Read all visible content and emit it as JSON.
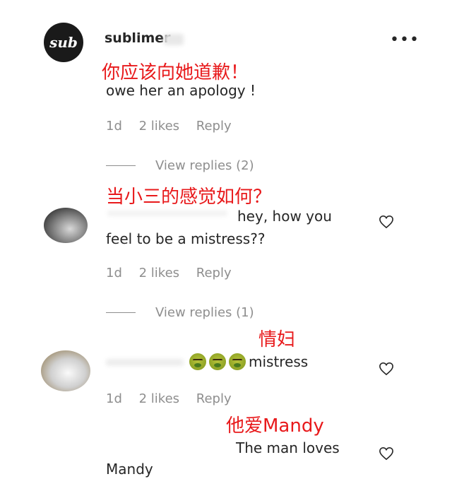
{
  "comments": [
    {
      "username": "sublimer",
      "avatar_text": "sub",
      "translation": "你应该向她道歉！",
      "text": "owe her an apology !",
      "time": "1d",
      "likes": "2 likes",
      "reply": "Reply",
      "view_replies": "View replies (2)"
    },
    {
      "translation": "当小三的感觉如何？",
      "text_line1": "hey, how you",
      "text_line2": "feel to be a mistress??",
      "time": "1d",
      "likes": "2 likes",
      "reply": "Reply",
      "view_replies": "View replies (1)"
    },
    {
      "translation": "情妇",
      "text": "mistress",
      "emoji": "nauseated-face-icon",
      "time": "1d",
      "likes": "2 likes",
      "reply": "Reply"
    },
    {
      "translation": "他爱Mandy",
      "text_line1": "The man loves",
      "text_line2": "Mandy"
    }
  ],
  "more_icon": "more-horizontal-icon",
  "heart_icon": "heart-outline-icon",
  "colors": {
    "annotation": "#e8191b",
    "meta": "#8e8e8e",
    "text": "#262626"
  }
}
